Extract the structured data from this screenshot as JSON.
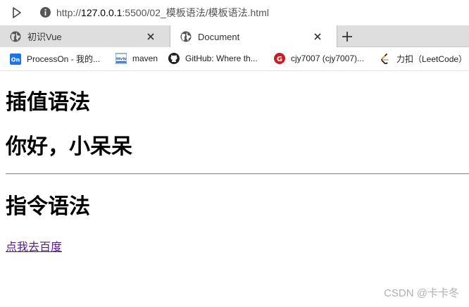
{
  "browser": {
    "url_prefix": "http://",
    "url_host": "127.0.0.1",
    "url_rest": ":5500/02_模板语法/模板语法.html",
    "tabs": [
      {
        "label": "初识Vue",
        "active": false
      },
      {
        "label": "Document",
        "active": true
      }
    ],
    "bookmarks": [
      {
        "label": "ProcessOn - 我的...",
        "icon": "processon-icon",
        "icon_text": "On"
      },
      {
        "label": "maven",
        "icon": "maven-icon",
        "icon_text": "MVN"
      },
      {
        "label": "GitHub: Where th...",
        "icon": "github-icon"
      },
      {
        "label": "cjy7007 (cjy7007)...",
        "icon": "gitee-icon",
        "icon_text": "G"
      },
      {
        "label": "力扣（LeetCode）",
        "icon": "leetcode-icon"
      }
    ]
  },
  "page": {
    "heading_interpolation": "插值语法",
    "greeting": "你好，小呆呆",
    "heading_directive": "指令语法",
    "link_text": "点我去百度"
  },
  "watermark": "CSDN @卡卡冬",
  "colors": {
    "tabstrip": "#dedede",
    "link_visited": "#551a8b",
    "processon_blue": "#1a73e8",
    "gitee_red": "#c71d23",
    "leetcode_orange": "#f89f1b"
  }
}
